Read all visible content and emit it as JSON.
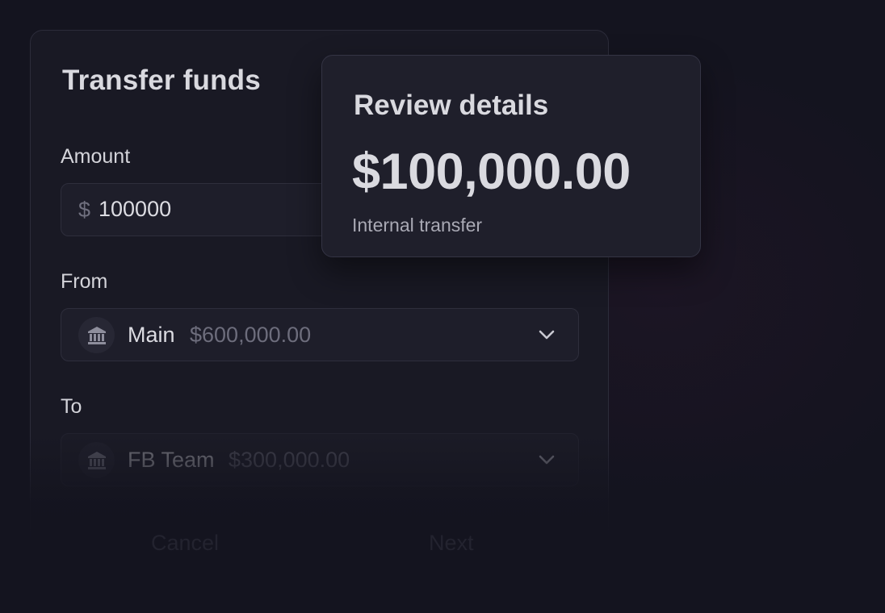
{
  "transfer": {
    "title": "Transfer funds",
    "amount": {
      "label": "Amount",
      "prefix": "$",
      "value": "100000"
    },
    "from": {
      "label": "From",
      "account_name": "Main",
      "account_balance": "$600,000.00",
      "icon": "bank-icon"
    },
    "to": {
      "label": "To",
      "account_name": "FB Team",
      "account_balance": "$300,000.00",
      "icon": "bank-icon"
    },
    "actions": {
      "cancel_label": "Cancel",
      "next_label": "Next"
    }
  },
  "review": {
    "title": "Review details",
    "amount": "$100,000.00",
    "subtitle": "Internal transfer"
  },
  "colors": {
    "background": "#14141f",
    "card": "#191924",
    "popover": "#1f1f2b",
    "text_primary": "#dcdce2",
    "text_muted": "#6d6d7c"
  }
}
